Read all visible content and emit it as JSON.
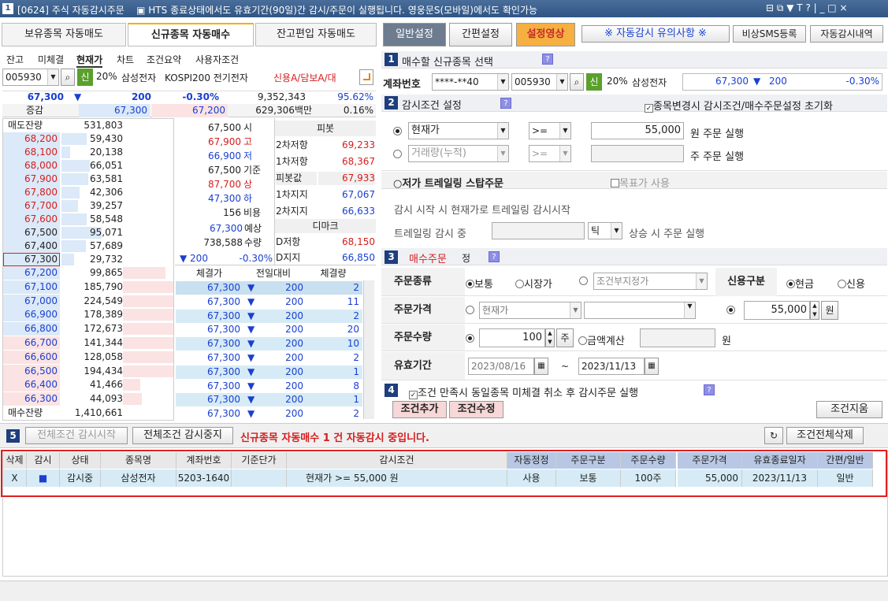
{
  "window": {
    "no": "1",
    "title": "[0624] 주식 자동감시주문",
    "notice": "▣ HTS 종료상태에서도 유효기간(90일)간 감시/주문이 실행됩니다. 영웅문S(모바일)에서도 확인가능",
    "controls": "⊟ ⧉ ▼ T ? | _ □ ×"
  },
  "top_tabs": [
    "보유종목 자동매도",
    "신규종목 자동매수",
    "잔고편입 자동매도"
  ],
  "top_buttons": {
    "general": "일반설정",
    "simple": "간편설정",
    "video": "설정영상",
    "caution": "※ 자동감시 유의사항 ※",
    "sms": "비상SMS등록",
    "history": "자동감시내역"
  },
  "sub_tabs": [
    "잔고",
    "미체결",
    "현재가",
    "차트",
    "조건요약",
    "사용자조건"
  ],
  "left_symbol": {
    "code": "005930",
    "badge": "신",
    "margin": "20%",
    "name": "삼성전자",
    "market": "KOSPI200  전기전자",
    "credit": "신용A/담보A/대"
  },
  "quote": {
    "price": "67,300",
    "arrow": "▼",
    "change": "200",
    "rate": "-0.30%",
    "volume": "9,352,343",
    "vol_rate": "95.62%",
    "label_diff": "증감",
    "prev_price": "67,300",
    "exp_price": "67,200",
    "amount": "629,306백만",
    "amount_rate": "0.16%"
  },
  "orderbook": {
    "sell_header": "매도잔량",
    "sell_total": "531,803",
    "buy_header": "매수잔량",
    "buy_total": "1,410,661",
    "asks": [
      {
        "price": "68,200",
        "qty": "59,430"
      },
      {
        "price": "68,100",
        "qty": "20,138"
      },
      {
        "price": "68,000",
        "qty": "66,051"
      },
      {
        "price": "67,900",
        "qty": "63,581"
      },
      {
        "price": "67,800",
        "qty": "42,306"
      },
      {
        "price": "67,700",
        "qty": "39,257"
      },
      {
        "price": "67,600",
        "qty": "58,548"
      },
      {
        "price": "67,500",
        "qty": "95,071"
      },
      {
        "price": "67,400",
        "qty": "57,689"
      },
      {
        "price": "67,300",
        "qty": "29,732"
      }
    ],
    "bids": [
      {
        "price": "67,200",
        "qty": "99,865"
      },
      {
        "price": "67,100",
        "qty": "185,790"
      },
      {
        "price": "67,000",
        "qty": "224,549"
      },
      {
        "price": "66,900",
        "qty": "178,389"
      },
      {
        "price": "66,800",
        "qty": "172,673"
      },
      {
        "price": "66,700",
        "qty": "141,344"
      },
      {
        "price": "66,600",
        "qty": "128,058"
      },
      {
        "price": "66,500",
        "qty": "194,434"
      },
      {
        "price": "66,400",
        "qty": "41,466"
      },
      {
        "price": "66,300",
        "qty": "44,093"
      }
    ]
  },
  "stats": [
    {
      "value": "67,500",
      "label": "시"
    },
    {
      "value": "67,900",
      "label": "고"
    },
    {
      "value": "66,900",
      "label": "저"
    },
    {
      "value": "67,500",
      "label": "기준"
    },
    {
      "value": "87,700",
      "label": "상"
    },
    {
      "value": "47,300",
      "label": "하"
    },
    {
      "value": "156",
      "label": "비용"
    }
  ],
  "expected": {
    "price": "67,300",
    "price_label": "예상",
    "qty": "738,588",
    "qty_label": "수량",
    "change": "▼ 200",
    "rate": "-0.30%"
  },
  "pivot": {
    "header": "피봇",
    "rows": [
      {
        "label": "2차저항",
        "value": "69,233"
      },
      {
        "label": "1차저항",
        "value": "68,367"
      },
      {
        "label": "피봇값",
        "value": "67,933"
      },
      {
        "label": "1차지지",
        "value": "67,067"
      },
      {
        "label": "2차지지",
        "value": "66,633"
      }
    ],
    "demark_header": "디마크",
    "demark": [
      {
        "label": "D저항",
        "value": "68,150"
      },
      {
        "label": "D지지",
        "value": "66,850"
      }
    ]
  },
  "trades": {
    "headers": [
      "체결가",
      "전일대비",
      "체결량"
    ],
    "rows": [
      {
        "price": "67,300",
        "arrow": "▼",
        "diff": "200",
        "qty": "2"
      },
      {
        "price": "67,300",
        "arrow": "▼",
        "diff": "200",
        "qty": "11"
      },
      {
        "price": "67,300",
        "arrow": "▼",
        "diff": "200",
        "qty": "2"
      },
      {
        "price": "67,300",
        "arrow": "▼",
        "diff": "200",
        "qty": "20"
      },
      {
        "price": "67,300",
        "arrow": "▼",
        "diff": "200",
        "qty": "10"
      },
      {
        "price": "67,300",
        "arrow": "▼",
        "diff": "200",
        "qty": "2"
      },
      {
        "price": "67,300",
        "arrow": "▼",
        "diff": "200",
        "qty": "1"
      },
      {
        "price": "67,300",
        "arrow": "▼",
        "diff": "200",
        "qty": "8"
      },
      {
        "price": "67,300",
        "arrow": "▼",
        "diff": "200",
        "qty": "1"
      },
      {
        "price": "67,300",
        "arrow": "▼",
        "diff": "200",
        "qty": "2"
      }
    ]
  },
  "section1": {
    "no": "1",
    "title": "매수할 신규종목 선택",
    "account_label": "계좌번호",
    "account": "****-**40",
    "code": "005930",
    "badge": "신",
    "margin": "20%",
    "name": "삼성전자",
    "price": "67,300",
    "arrow": "▼",
    "change": "200",
    "rate": "-0.30%"
  },
  "section2": {
    "no": "2",
    "title": "감시조건 설정",
    "reset_check": "종목변경시 감시조건/매수주문설정 초기화",
    "cond1": {
      "field": "현재가",
      "op": ">=",
      "value": "55,000",
      "suffix": "원 주문 실행"
    },
    "cond2": {
      "field": "거래량(누적)",
      "op": ">=",
      "value": "",
      "suffix": "주 주문 실행"
    },
    "trailing_title": "○저가 트레일링 스탑주문",
    "target_check": "목표가 사용",
    "trailing_desc": "감시 시작 시 현재가로 트레일링 감시시작",
    "trailing_label": "트레일링 감시 중",
    "tick": "틱",
    "trailing_suffix": "상승 시 주문 실행"
  },
  "section3": {
    "no": "3",
    "title": "매수주문",
    "title_suffix": "정",
    "order_type_label": "주문종류",
    "opt_normal": "보통",
    "opt_market": "시장가",
    "opt_cond": "조건부지정가",
    "credit_label": "신용구분",
    "opt_cash": "현금",
    "opt_credit": "신용",
    "price_label": "주문가격",
    "price_field": "현재가",
    "price_value": "55,000",
    "price_unit": "원",
    "qty_label": "주문수량",
    "qty_value": "100",
    "qty_unit": "주",
    "amount_opt": "금액계산",
    "amount_unit": "원",
    "valid_label": "유효기간",
    "date_from": "2023/08/16",
    "tilde": "~",
    "date_to": "2023/11/13"
  },
  "section4": {
    "no": "4",
    "text": "조건 만족시 동일종목 미체결 취소 후 감시주문 실행",
    "add": "조건추가",
    "edit": "조건수정",
    "clear": "조건지움"
  },
  "section5": {
    "no": "5",
    "start_btn": "전체조건 감시시작",
    "stop_btn": "전체조건 감시중지",
    "message": "신규종목 자동매수 1 건 자동감시 중입니다.",
    "delete_all": "조건전체삭제"
  },
  "grid": {
    "headers": [
      "삭제",
      "감시",
      "상태",
      "종목명",
      "계좌번호",
      "기준단가",
      "감시조건",
      "자동정정",
      "주문구분",
      "주문수량",
      "주문가격",
      "유효종료일자",
      "간편/일반"
    ],
    "row": {
      "del": "X",
      "watch": "■",
      "status": "감시중",
      "name": "삼성전자",
      "account": "5203-1640",
      "base": "",
      "cond": "현재가 >= 55,000 원",
      "auto": "사용",
      "type": "보통",
      "qty": "100주",
      "price": "55,000",
      "end": "2023/11/13",
      "mode": "일반"
    }
  },
  "colors": {
    "accent": "#1e3e7c",
    "highlight_red": "#d61d1d",
    "blue": "#1a3fd1",
    "video_btn": "#f5b041"
  }
}
